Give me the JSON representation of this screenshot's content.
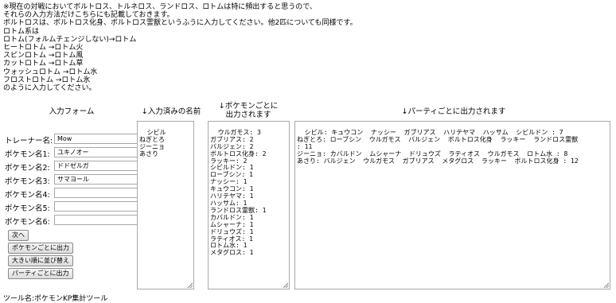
{
  "notice": [
    "※現在の対戦においてボルトロス、トルネロス、ランドロス、ロトムは特に頻出すると思うので、",
    "それらの入力方法だけこちらにも記載しておきます。",
    "ボルトロスは、ボルトロス化身、ボルトロス霊獣というふうに入力してください。他2匹についても同様です。",
    "ロトム系は",
    "ロトム(フォルムチェンジしない)→ロトム",
    "ヒートロトム →ロトム火",
    "スピンロトム →ロトム風",
    "カットロトム →ロトム草",
    "ウォッシュロトム →ロトム水",
    "フロストロトム →ロトム氷",
    "のように入力してください。"
  ],
  "form": {
    "title": "入力フォーム",
    "fields": [
      {
        "label": "トレーナー名:",
        "value": "Mow"
      },
      {
        "label": "ポケモン名1:",
        "value": "ユキノオー"
      },
      {
        "label": "ポケモン名2:",
        "value": "ドドゼルガ"
      },
      {
        "label": "ポケモン名3:",
        "value": "サマヨール"
      },
      {
        "label": "ポケモン名4:",
        "value": ""
      },
      {
        "label": "ポケモン名5:",
        "value": ""
      },
      {
        "label": "ポケモン名6:",
        "value": ""
      }
    ],
    "buttons": {
      "next": "次へ",
      "per_pokemon": "ポケモンごとに出力",
      "sort": "大きい順に並び替え",
      "per_party": "パーティごとに出力"
    }
  },
  "names_panel": {
    "header": "↓入力済みの名前",
    "content": "シビル\nねぎとろ\nジーニョ\nあさり"
  },
  "pokemon_panel": {
    "header1": "↓ポケモンごとに",
    "header2": "出力されます",
    "content": "ウルガモス: 3\nガブリアス: 2\nバルジェン: 2\nボルトロス化身: 2\nラッキー: 2\nシビルドン: 1\nローブシン: 1\nナッシー: 1\nキュウコン: 1\nハリテヤマ: 1\nハッサム: 1\nランドロス霊獣: 1\nカバルドン: 1\nムシャーナ: 1\nドリュウズ: 1\nラティオス: 1\nロトム水: 1\nメタグロス: 1"
  },
  "party_panel": {
    "header": "↓パーティごとに出力されます",
    "content": "シビル: キュウコン  ナッシー  ガブリアス  ハリテヤマ  ハッサム  シビルドン : 7\nねぎとろ: ローブシン  ウルガモス  バルジェン  ボルトロス化身  ラッキー  ランドロス霊獣\n: 11\nジーニョ: カバルドン  ムシャーナ  ドリュウズ  ラティオス  ウルガモス  ロトム水 : 8\nあさり: バルジェン  ウルガモス  ガブリアス  メタグロス  ラッキー  ボルトロス化身 : 12"
  },
  "footer": "ツール名:ポケモンKP集計ツール"
}
